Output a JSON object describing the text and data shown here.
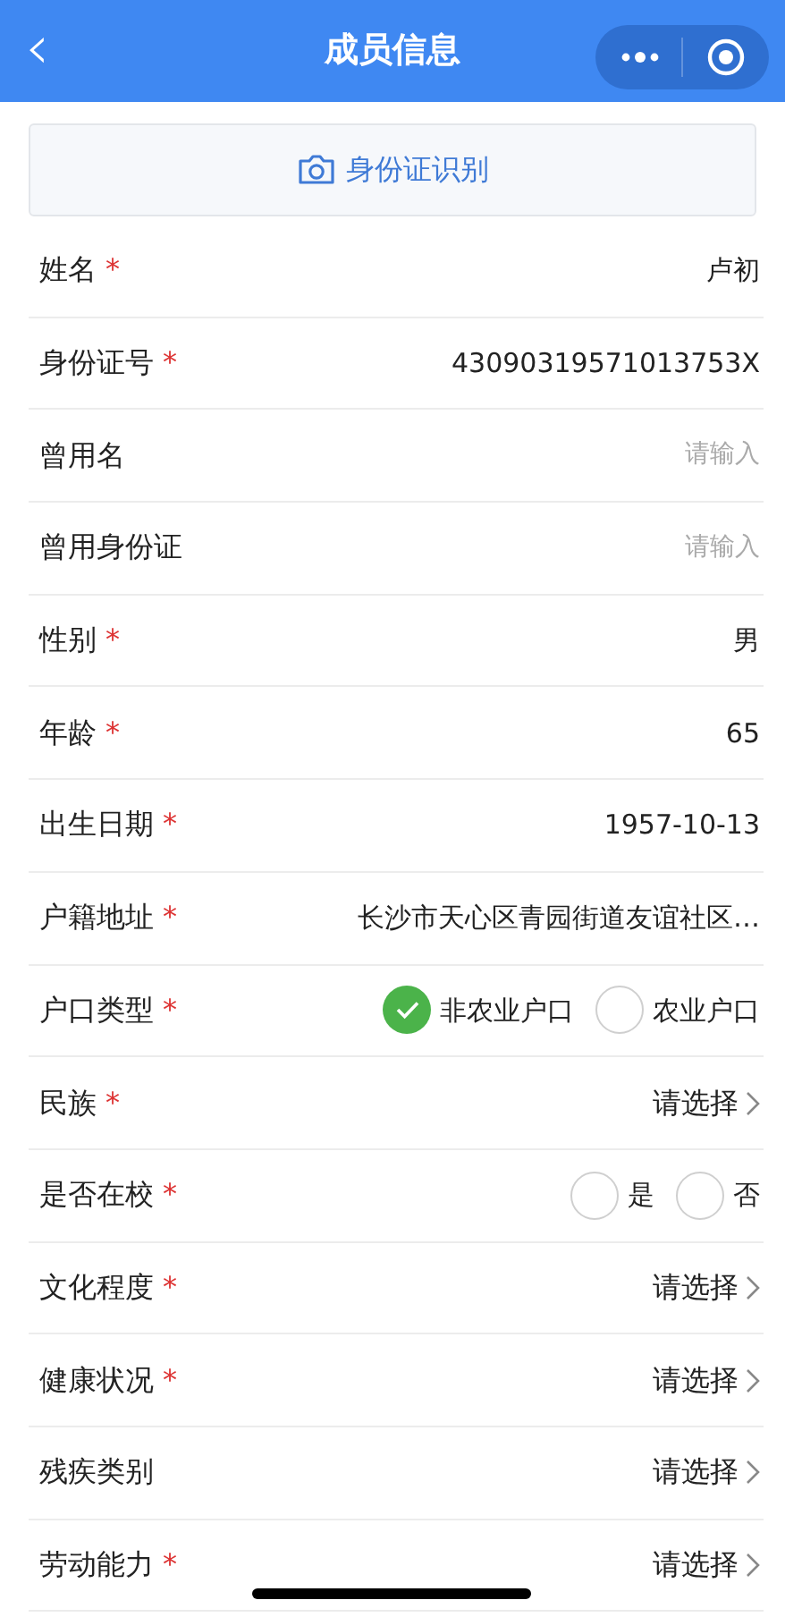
{
  "nav_bar": {
    "title": "成员信息",
    "back_icon": "‹"
  },
  "id_scan_button": {
    "label": "身份证识别"
  },
  "fields": [
    {
      "kind": "value",
      "label": "姓名",
      "required_mark": "*",
      "value": "卢初"
    },
    {
      "kind": "value",
      "label": "身份证号",
      "required_mark": "*",
      "value": "43090319571013753X"
    },
    {
      "kind": "input",
      "label": "曾用名",
      "placeholder": "请输入"
    },
    {
      "kind": "input",
      "label": "曾用身份证",
      "placeholder": "请输入"
    },
    {
      "kind": "value",
      "label": "性别",
      "required_mark": "*",
      "value": "男"
    },
    {
      "kind": "value",
      "label": "年龄",
      "required_mark": "*",
      "value": "65"
    },
    {
      "kind": "value",
      "label": "出生日期",
      "required_mark": "*",
      "value": "1957-10-13"
    },
    {
      "kind": "value",
      "label": "户籍地址",
      "required_mark": "*",
      "value": "长沙市天心区青园街道友谊社区…"
    },
    {
      "kind": "radio",
      "label": "户口类型",
      "required_mark": "*",
      "options": [
        {
          "label": "非农业户口",
          "selected": true
        },
        {
          "label": "农业户口",
          "selected": false
        }
      ]
    },
    {
      "kind": "select",
      "label": "民族",
      "required_mark": "*",
      "value": "请选择"
    },
    {
      "kind": "radio",
      "label": "是否在校",
      "required_mark": "*",
      "options": [
        {
          "label": "是",
          "selected": false
        },
        {
          "label": "否",
          "selected": false
        }
      ]
    },
    {
      "kind": "select",
      "label": "文化程度",
      "required_mark": "*",
      "value": "请选择"
    },
    {
      "kind": "select",
      "label": "健康状况",
      "required_mark": "*",
      "value": "请选择"
    },
    {
      "kind": "select",
      "label": "残疾类别",
      "value": "请选择"
    },
    {
      "kind": "select",
      "label": "劳动能力",
      "required_mark": "*",
      "value": "请选择"
    }
  ]
}
